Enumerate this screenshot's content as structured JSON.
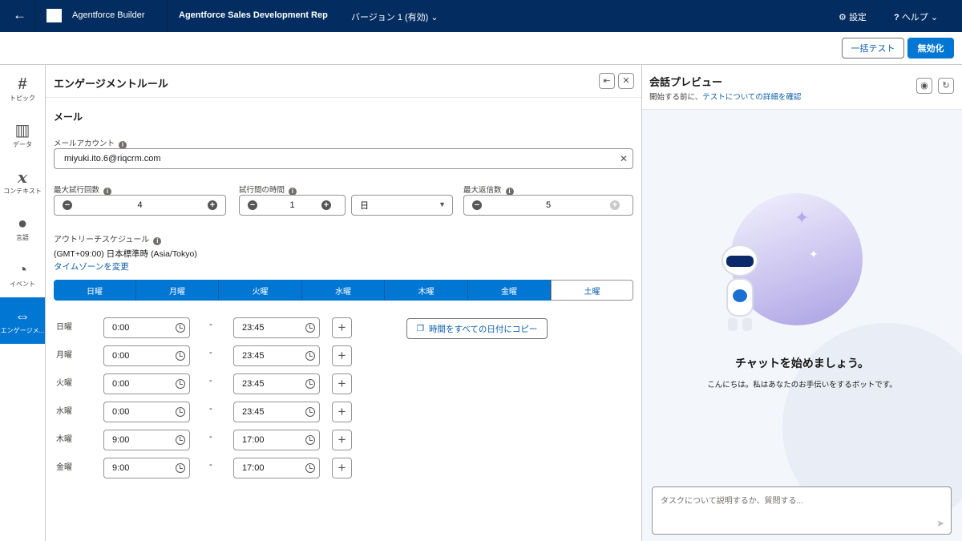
{
  "topbar": {
    "back_icon": "arrow-left",
    "app_name": "Agentforce Builder",
    "agent_name": "Agentforce Sales Development Rep",
    "version": "バージョン 1 (有効)",
    "settings": "設定",
    "help": "ヘルプ"
  },
  "actions": {
    "batch_test": "一括テスト",
    "deactivate": "無効化"
  },
  "sidebar": {
    "items": [
      {
        "label": "トピック",
        "icon": "#"
      },
      {
        "label": "データ",
        "icon": "book"
      },
      {
        "label": "コンテキスト",
        "icon": "x"
      },
      {
        "label": "言語",
        "icon": "palette"
      },
      {
        "label": "イベント",
        "icon": "signal"
      },
      {
        "label": "エンゲージメ...",
        "icon": "share"
      }
    ]
  },
  "panel": {
    "title": "エンゲージメントルール",
    "section": "メール",
    "email_label": "メールアカウント",
    "email_value": "miyuki.ito.6@riqcrm.com",
    "max_attempts_label": "最大試行回数",
    "max_attempts": "4",
    "interval_label": "試行間の時間",
    "interval": "1",
    "interval_unit": "日",
    "max_replies_label": "最大返信数",
    "max_replies": "5",
    "schedule_label": "アウトリーチスケジュール",
    "timezone": "(GMT+09:00) 日本標準時 (Asia/Tokyo)",
    "change_tz": "タイムゾーンを変更",
    "tabs": [
      "日曜",
      "月曜",
      "火曜",
      "水曜",
      "木曜",
      "金曜",
      "土曜"
    ],
    "copy_button": "時間をすべての日付にコピー",
    "dash": "-",
    "rows": [
      {
        "day": "日曜",
        "start": "0:00",
        "end": "23:45"
      },
      {
        "day": "月曜",
        "start": "0:00",
        "end": "23:45"
      },
      {
        "day": "火曜",
        "start": "0:00",
        "end": "23:45"
      },
      {
        "day": "水曜",
        "start": "0:00",
        "end": "23:45"
      },
      {
        "day": "木曜",
        "start": "9:00",
        "end": "17:00"
      },
      {
        "day": "金曜",
        "start": "9:00",
        "end": "17:00"
      }
    ]
  },
  "preview": {
    "title": "会話プレビュー",
    "subtitle": "開始する前に、",
    "link": "テストについての詳細を確認",
    "heading": "チャットを始めましょう。",
    "message": "こんにちは。私はあなたのお手伝いをするボットです。",
    "input_placeholder": "タスクについて説明するか、質問する..."
  },
  "colors": {
    "nav": "#032d60",
    "brand": "#0176d3"
  }
}
